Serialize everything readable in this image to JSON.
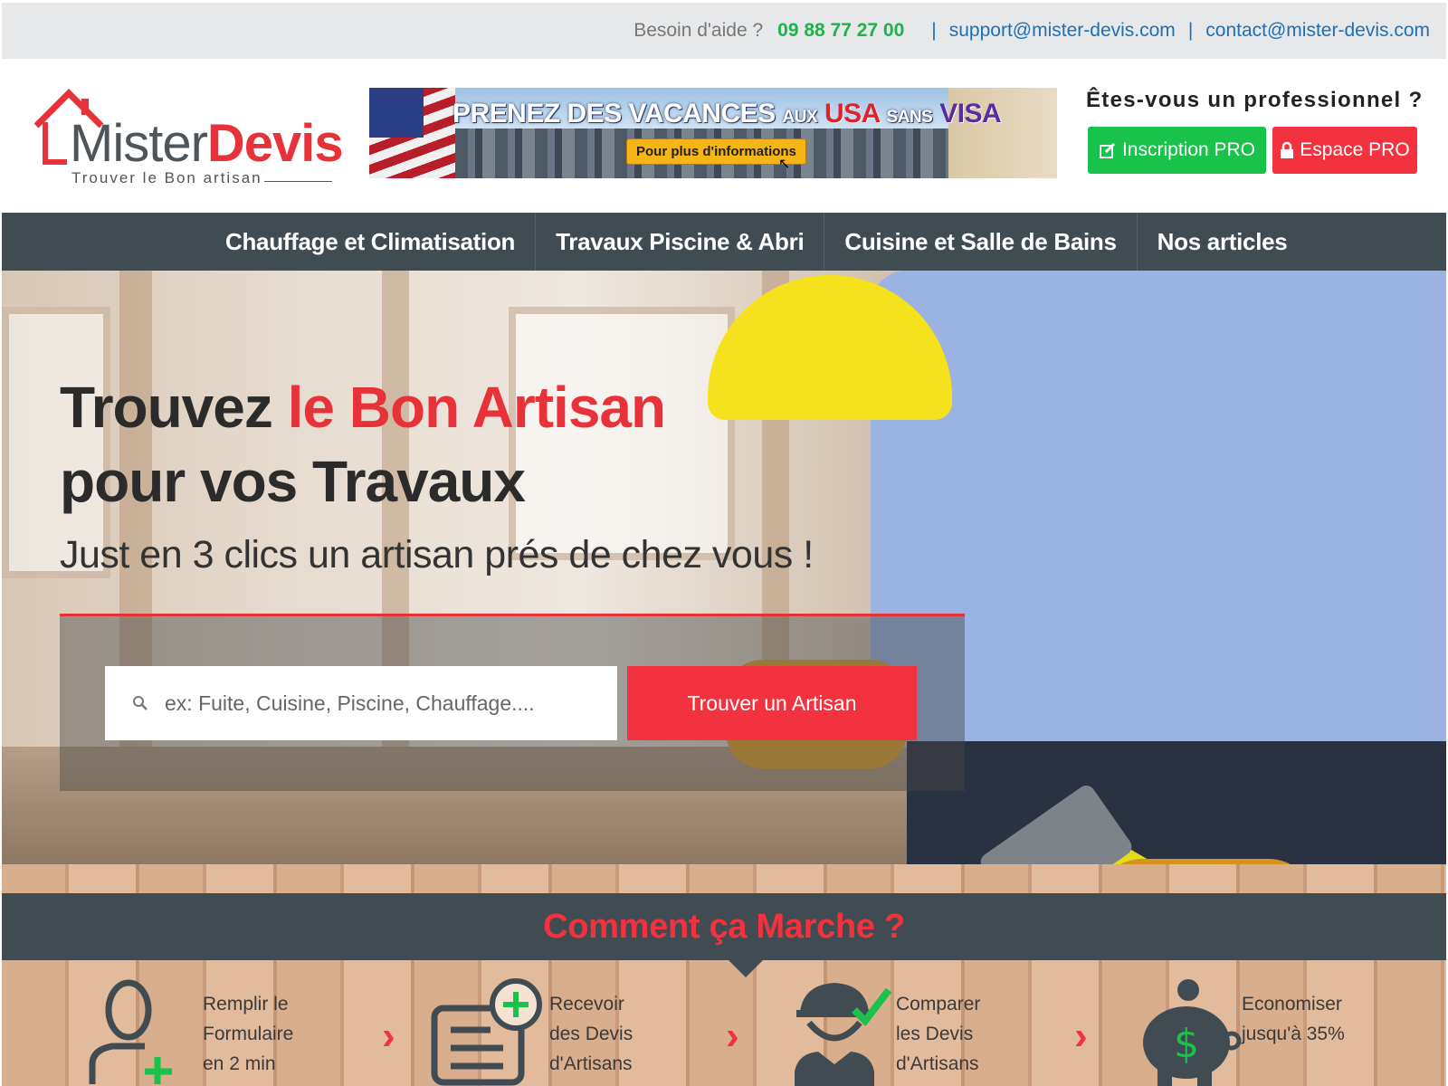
{
  "topbar": {
    "help_label": "Besoin d'aide ?",
    "phone": "09 88 77 27 00",
    "separator": "|",
    "support_email": "support@mister-devis.com",
    "contact_email": "contact@mister-devis.com"
  },
  "header": {
    "logo": {
      "mister": "Mister",
      "devis": "Devis",
      "tagline": "Trouver le Bon artisan"
    },
    "banner": {
      "headline_1": "PRENEZ DES VACANCES",
      "headline_aux": "AUX",
      "headline_usa": "USA",
      "headline_sans": "SANS",
      "headline_visa": "VISA",
      "info_button": "Pour plus d'informations"
    },
    "pro_question": "Êtes-vous un professionnel ?",
    "inscription_button": "Inscription PRO",
    "espace_button": "Espace PRO"
  },
  "nav": {
    "items": [
      {
        "label": "Chauffage et Climatisation"
      },
      {
        "label": "Travaux Piscine & Abri"
      },
      {
        "label": "Cuisine et Salle de Bains"
      },
      {
        "label": "Nos articles"
      }
    ]
  },
  "hero": {
    "title_1": "Trouvez ",
    "title_red": "le Bon Artisan",
    "title_2": "pour vos Travaux",
    "subtitle": "Just en 3 clics un artisan prés de chez vous !",
    "search_placeholder": "ex: Fuite, Cuisine, Piscine, Chauffage....",
    "search_button": "Trouver un Artisan"
  },
  "how": {
    "title": "Comment ça Marche ?",
    "steps": [
      {
        "line1": "Remplir le",
        "line2": "Formulaire",
        "line3": "en 2 min",
        "icon": "user-add-icon"
      },
      {
        "line1": "Recevoir",
        "line2": "des Devis",
        "line3": "d'Artisans",
        "icon": "document-add-icon"
      },
      {
        "line1": "Comparer",
        "line2": "les Devis",
        "line3": "d'Artisans",
        "icon": "worker-check-icon"
      },
      {
        "line1": "Economiser",
        "line2": "jusqu'à 35%",
        "line3": "",
        "icon": "piggy-bank-icon"
      }
    ],
    "chevron": "›"
  },
  "colors": {
    "accent_red": "#f2333f",
    "accent_green": "#19c24a",
    "nav_bg": "#414c52",
    "link_blue": "#1f6fb5"
  }
}
